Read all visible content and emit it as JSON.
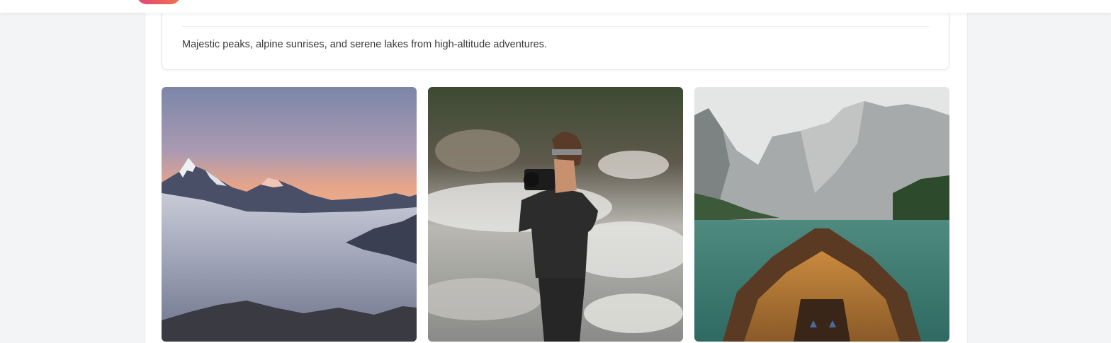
{
  "album": {
    "description": "Majestic peaks, alpine sunrises, and serene lakes from high-altitude adventures."
  },
  "photos": [
    {
      "subject": "mountain sunrise above a sea of clouds"
    },
    {
      "subject": "woman photographing by a river"
    },
    {
      "subject": "wooden boat on an alpine lake"
    }
  ],
  "colors": {
    "background": "#f3f4f6",
    "card": "#ffffff",
    "brand_gradient_start": "#e2457a",
    "brand_gradient_end": "#f0734a"
  }
}
